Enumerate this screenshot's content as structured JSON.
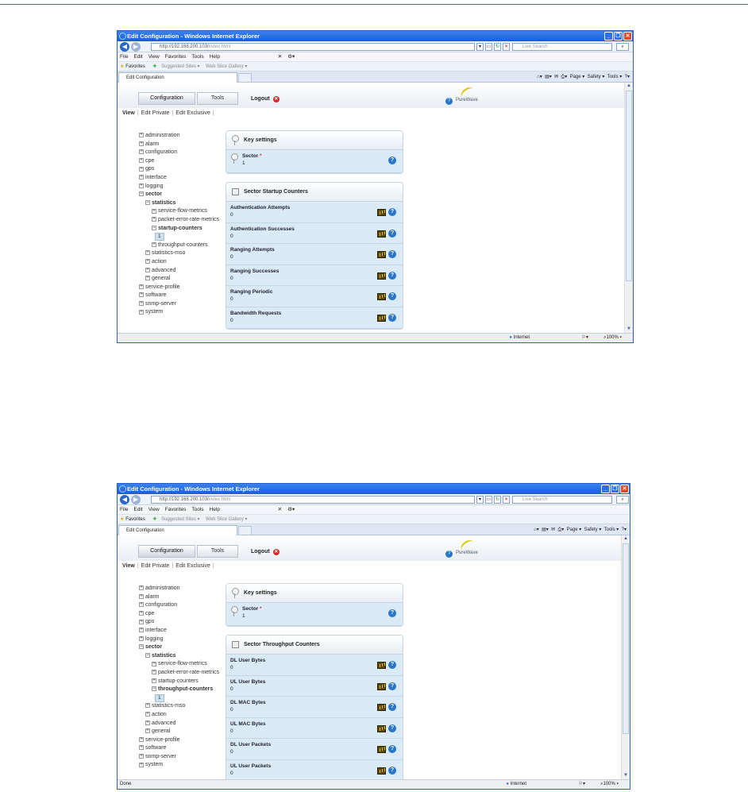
{
  "screens": [
    {
      "browser": {
        "title": "Edit Configuration - Windows Internet Explorer",
        "url_host": "http://192.168.200.103/",
        "url_path": "index.html",
        "search_placeholder": "Live Search",
        "menu": [
          "File",
          "Edit",
          "View",
          "Favorites",
          "Tools",
          "Help"
        ],
        "favorites_label": "Favorites",
        "favorites_items": [
          "Suggested Sites ▾",
          "Web Slice Gallery ▾"
        ],
        "tab_title": "Edit Configuration",
        "command_bar": [
          "Page ▾",
          "Safety ▾",
          "Tools ▾"
        ],
        "status_text": "",
        "zone": "Internet",
        "zoom": "100%"
      },
      "app": {
        "tabs": [
          "Configuration",
          "Tools"
        ],
        "logout": "Logout",
        "brand": "PureWave",
        "subnav": [
          "View",
          "Edit Private",
          "Edit Exclusive"
        ],
        "tree": [
          {
            "label": "administration",
            "level": 0,
            "state": "plus"
          },
          {
            "label": "alarm",
            "level": 0,
            "state": "plus"
          },
          {
            "label": "configuration",
            "level": 0,
            "state": "plus"
          },
          {
            "label": "cpe",
            "level": 0,
            "state": "plus"
          },
          {
            "label": "gps",
            "level": 0,
            "state": "plus"
          },
          {
            "label": "interface",
            "level": 0,
            "state": "plus"
          },
          {
            "label": "logging",
            "level": 0,
            "state": "plus"
          },
          {
            "label": "sector",
            "level": 0,
            "state": "minus",
            "bold": true
          },
          {
            "label": "statistics",
            "level": 1,
            "state": "minus",
            "bold": true
          },
          {
            "label": "service-flow-metrics",
            "level": 2,
            "state": "plus"
          },
          {
            "label": "packet-error-rate-metrics",
            "level": 2,
            "state": "plus"
          },
          {
            "label": "startup-counters",
            "level": 2,
            "state": "minus",
            "bold": true
          },
          {
            "label": "1",
            "level": 3,
            "state": "leaf"
          },
          {
            "label": "throughput-counters",
            "level": 2,
            "state": "plus"
          },
          {
            "label": "statistics-mso",
            "level": 1,
            "state": "plus"
          },
          {
            "label": "action",
            "level": 1,
            "state": "plus"
          },
          {
            "label": "advanced",
            "level": 1,
            "state": "plus"
          },
          {
            "label": "general",
            "level": 1,
            "state": "plus"
          },
          {
            "label": "service-profile",
            "level": 0,
            "state": "plus"
          },
          {
            "label": "software",
            "level": 0,
            "state": "plus"
          },
          {
            "label": "snmp-server",
            "level": 0,
            "state": "plus"
          },
          {
            "label": "system",
            "level": 0,
            "state": "plus"
          }
        ],
        "key_panel": {
          "title": "Key settings",
          "field": "Sector",
          "required": "*",
          "value": "1"
        },
        "counter_panel": {
          "title": "Sector Startup Counters",
          "rows": [
            {
              "label": "Authentication Attempts",
              "value": "0"
            },
            {
              "label": "Authentication Successes",
              "value": "0"
            },
            {
              "label": "Ranging Attempts",
              "value": "0"
            },
            {
              "label": "Ranging Successes",
              "value": "0"
            },
            {
              "label": "Ranging Periodic",
              "value": "0"
            },
            {
              "label": "Bandwidth Requests",
              "value": "0"
            }
          ]
        }
      }
    },
    {
      "browser": {
        "title": "Edit Configuration - Windows Internet Explorer",
        "url_host": "http://192.168.200.103/",
        "url_path": "index.html",
        "search_placeholder": "Live Search",
        "menu": [
          "File",
          "Edit",
          "View",
          "Favorites",
          "Tools",
          "Help"
        ],
        "favorites_label": "Favorites",
        "favorites_items": [
          "Suggested Sites ▾",
          "Web Slice Gallery ▾"
        ],
        "tab_title": "Edit Configuration",
        "command_bar": [
          "Page ▾",
          "Safety ▾",
          "Tools ▾"
        ],
        "status_text": "Done",
        "zone": "Internet",
        "zoom": "100%"
      },
      "app": {
        "tabs": [
          "Configuration",
          "Tools"
        ],
        "logout": "Logout",
        "brand": "PureWave",
        "subnav": [
          "View",
          "Edit Private",
          "Edit Exclusive"
        ],
        "tree": [
          {
            "label": "administration",
            "level": 0,
            "state": "plus"
          },
          {
            "label": "alarm",
            "level": 0,
            "state": "plus"
          },
          {
            "label": "configuration",
            "level": 0,
            "state": "plus"
          },
          {
            "label": "cpe",
            "level": 0,
            "state": "plus"
          },
          {
            "label": "gps",
            "level": 0,
            "state": "plus"
          },
          {
            "label": "interface",
            "level": 0,
            "state": "plus"
          },
          {
            "label": "logging",
            "level": 0,
            "state": "plus"
          },
          {
            "label": "sector",
            "level": 0,
            "state": "minus",
            "bold": true
          },
          {
            "label": "statistics",
            "level": 1,
            "state": "minus",
            "bold": true
          },
          {
            "label": "service-flow-metrics",
            "level": 2,
            "state": "plus"
          },
          {
            "label": "packet-error-rate-metrics",
            "level": 2,
            "state": "plus"
          },
          {
            "label": "startup-counters",
            "level": 2,
            "state": "plus"
          },
          {
            "label": "throughput-counters",
            "level": 2,
            "state": "minus",
            "bold": true
          },
          {
            "label": "1",
            "level": 3,
            "state": "leaf"
          },
          {
            "label": "statistics-mso",
            "level": 1,
            "state": "plus"
          },
          {
            "label": "action",
            "level": 1,
            "state": "plus"
          },
          {
            "label": "advanced",
            "level": 1,
            "state": "plus"
          },
          {
            "label": "general",
            "level": 1,
            "state": "plus"
          },
          {
            "label": "service-profile",
            "level": 0,
            "state": "plus"
          },
          {
            "label": "software",
            "level": 0,
            "state": "plus"
          },
          {
            "label": "snmp-server",
            "level": 0,
            "state": "plus"
          },
          {
            "label": "system",
            "level": 0,
            "state": "plus"
          }
        ],
        "key_panel": {
          "title": "Key settings",
          "field": "Sector",
          "required": "*",
          "value": "1"
        },
        "counter_panel": {
          "title": "Sector Throughput Counters",
          "rows": [
            {
              "label": "DL User Bytes",
              "value": "0"
            },
            {
              "label": "UL User Bytes",
              "value": "0"
            },
            {
              "label": "DL MAC Bytes",
              "value": "0"
            },
            {
              "label": "UL MAC Bytes",
              "value": "0"
            },
            {
              "label": "DL User Packets",
              "value": "0"
            },
            {
              "label": "UL User Packets",
              "value": "0"
            }
          ]
        }
      }
    }
  ]
}
